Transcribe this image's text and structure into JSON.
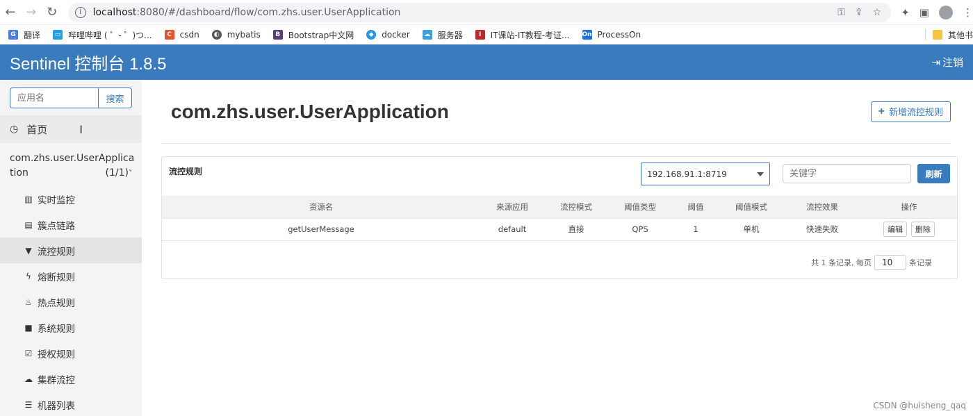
{
  "browser": {
    "url_host": "localhost",
    "url_path": ":8080/#/dashboard/flow/com.zhs.user.UserApplication",
    "bookmarks": [
      {
        "label": "翻译",
        "icon": "translate-icon",
        "color": "#4a7fe0"
      },
      {
        "label": "哔哩哔哩 ( ゜- ゜)つ...",
        "icon": "bilibili-icon",
        "color": "#20a0e0"
      },
      {
        "label": "csdn",
        "icon": "csdn-icon",
        "color": "#e5502e"
      },
      {
        "label": "mybatis",
        "icon": "globe-icon",
        "color": "#555555"
      },
      {
        "label": "Bootstrap中文网",
        "icon": "bootstrap-icon",
        "color": "#563d7c"
      },
      {
        "label": "docker",
        "icon": "docker-icon",
        "color": "#2496ed"
      },
      {
        "label": "服务器",
        "icon": "cloud-icon",
        "color": "#3aa0e0"
      },
      {
        "label": "IT课站-IT教程-考证...",
        "icon": "itkz-icon",
        "color": "#c0282d"
      },
      {
        "label": "ProcessOn",
        "icon": "processon-icon",
        "color": "#1e6fd9"
      }
    ],
    "other_bookmarks": "其他书"
  },
  "header": {
    "title": "Sentinel 控制台 1.8.5",
    "logout": "注销"
  },
  "sidebar": {
    "search_placeholder": "应用名",
    "search_button": "搜索",
    "home": "首页",
    "app_name_line1": "com.zhs.user.UserApplica",
    "app_name_line2": "tion",
    "app_count": "(1/1)",
    "items": [
      {
        "label": "实时监控",
        "icon": "bar-chart-icon"
      },
      {
        "label": "簇点链路",
        "icon": "list-icon"
      },
      {
        "label": "流控规则",
        "icon": "filter-icon"
      },
      {
        "label": "熔断规则",
        "icon": "flash-icon"
      },
      {
        "label": "热点规则",
        "icon": "fire-icon"
      },
      {
        "label": "系统规则",
        "icon": "lock-icon"
      },
      {
        "label": "授权规则",
        "icon": "check-icon"
      },
      {
        "label": "集群流控",
        "icon": "cloud-icon"
      },
      {
        "label": "机器列表",
        "icon": "th-list-icon"
      }
    ]
  },
  "main": {
    "title": "com.zhs.user.UserApplication",
    "add_button": "新增流控规则",
    "panel_title": "流控规则",
    "machine": "192.168.91.1:8719",
    "keyword_placeholder": "关键字",
    "refresh": "刷新",
    "columns": [
      "资源名",
      "来源应用",
      "流控模式",
      "阈值类型",
      "阈值",
      "阈值模式",
      "流控效果",
      "操作"
    ],
    "rows": [
      {
        "resource": "getUserMessage",
        "origin": "default",
        "mode": "直接",
        "grade": "QPS",
        "count": "1",
        "cluster": "单机",
        "effect": "快速失败",
        "edit": "编辑",
        "delete": "删除"
      }
    ],
    "pager_prefix": "共 1 条记录, 每页",
    "page_size": "10",
    "pager_suffix": "条记录"
  },
  "watermark": "CSDN @huisheng_qaq"
}
